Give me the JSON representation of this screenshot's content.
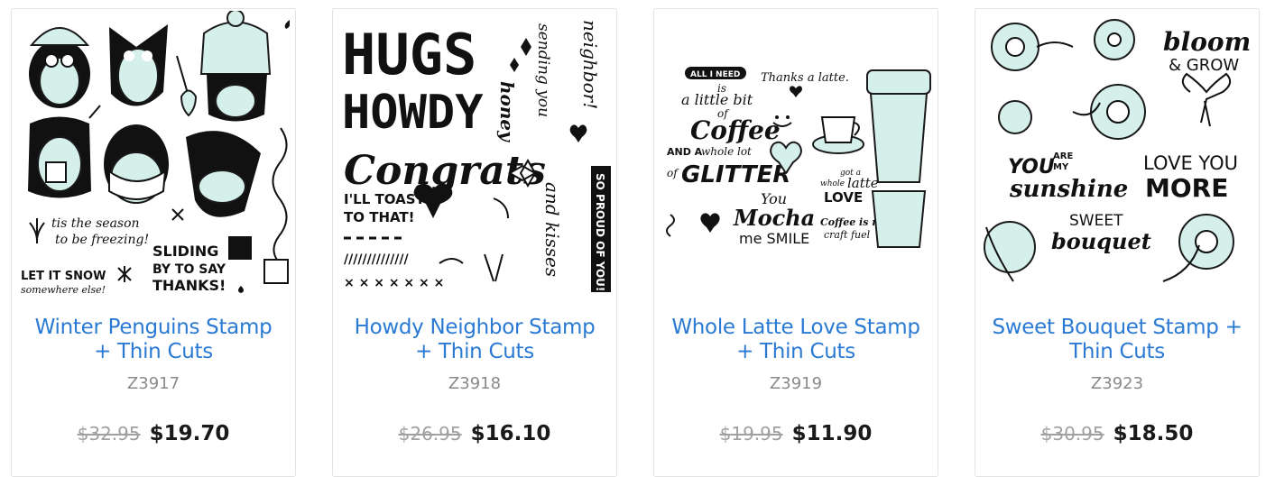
{
  "products": [
    {
      "title": "Winter Penguins Stamp + Thin Cuts",
      "sku": "Z3917",
      "price_old": "$32.95",
      "price_new": "$19.70",
      "image_text": [
        "tis the season",
        "to be freezing!",
        "SLIDING",
        "BY TO SAY",
        "THANKS!",
        "LET IT SNOW",
        "somewhere else!"
      ]
    },
    {
      "title": "Howdy Neighbor Stamp + Thin Cuts",
      "sku": "Z3918",
      "price_old": "$26.95",
      "price_new": "$16.10",
      "image_text": [
        "HUGS",
        "HOWDY",
        "Congrats",
        "I'LL TOAST",
        "TO THAT!",
        "sending you",
        "neighbor!",
        "honey",
        "and kisses",
        "SO PROUD OF YOU!"
      ]
    },
    {
      "title": "Whole Latte Love Stamp + Thin Cuts",
      "sku": "Z3919",
      "price_old": "$19.95",
      "price_new": "$11.90",
      "image_text": [
        "ALL I NEED",
        "is",
        "a little bit",
        "of",
        "Coffee",
        "AND A",
        "whole lot",
        "of",
        "GLITTER",
        "Thanks a latte.",
        "You",
        "Mocha",
        "me SMILE",
        "got a",
        "whole",
        "latte",
        "LOVE",
        "Coffee is my",
        "craft fuel"
      ]
    },
    {
      "title": "Sweet Bouquet Stamp + Thin Cuts",
      "sku": "Z3923",
      "price_old": "$30.95",
      "price_new": "$18.50",
      "image_text": [
        "bloom",
        "& GROW",
        "YOU",
        "ARE",
        "MY",
        "sunshine",
        "LOVE YOU",
        "MORE",
        "SWEET",
        "bouquet"
      ]
    }
  ]
}
